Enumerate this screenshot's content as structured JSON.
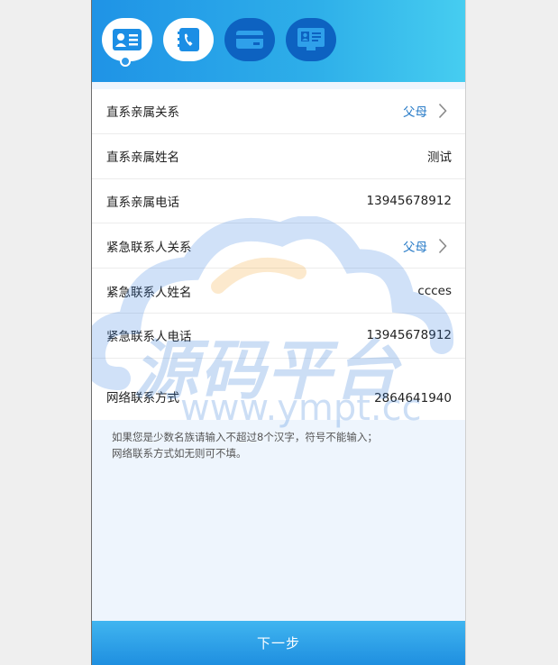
{
  "steps": [
    {
      "name": "contact-card-icon",
      "state": "active"
    },
    {
      "name": "phone-book-icon",
      "state": "active"
    },
    {
      "name": "bank-card-icon",
      "state": "inactive"
    },
    {
      "name": "id-card-icon",
      "state": "inactive"
    }
  ],
  "form": {
    "rows": [
      {
        "label": "直系亲属关系",
        "value": "父母",
        "selectable": true
      },
      {
        "label": "直系亲属姓名",
        "value": "测试",
        "selectable": false
      },
      {
        "label": "直系亲属电话",
        "value": "13945678912",
        "selectable": false
      },
      {
        "label": "紧急联系人关系",
        "value": "父母",
        "selectable": true
      },
      {
        "label": "紧急联系人姓名",
        "value": "ccces",
        "selectable": false
      },
      {
        "label": "紧急联系人电话",
        "value": "13945678912",
        "selectable": false
      },
      {
        "label": "网络联系方式",
        "value": "2864641940",
        "selectable": false
      }
    ]
  },
  "note": {
    "line1": "如果您是少数名族请输入不超过8个汉字，符号不能输入；",
    "line2": "网络联系方式如无则可不填。"
  },
  "watermark": {
    "title": "源码平台",
    "url": "www.ympt.cc"
  },
  "footer": {
    "next_label": "下一步"
  },
  "colors": {
    "header_start": "#1f93e6",
    "header_end": "#46cdf0",
    "link": "#2b7dc8",
    "inactive_step": "#0d62c1"
  }
}
